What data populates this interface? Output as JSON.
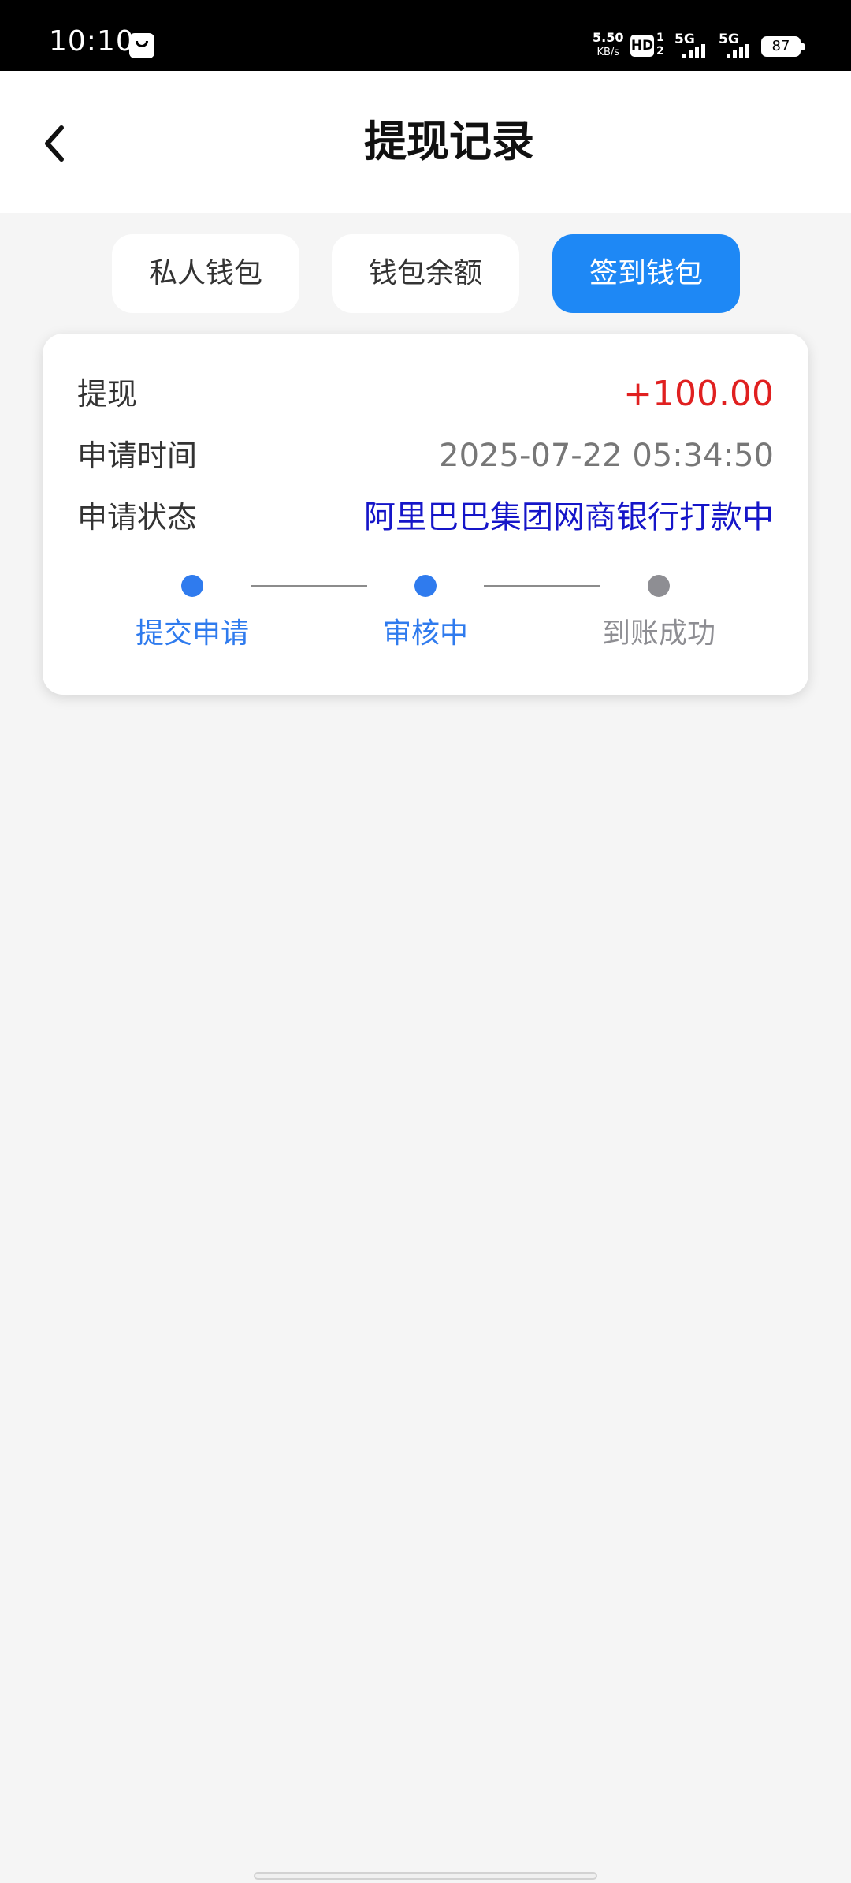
{
  "status_bar": {
    "time": "10:10",
    "net_speed_value": "5.50",
    "net_speed_unit": "KB/s",
    "hd": "HD",
    "hd_sub_top": "1",
    "hd_sub_bottom": "2",
    "signal_1": "5G",
    "signal_2": "5G",
    "battery": "87"
  },
  "header": {
    "title": "提现记录"
  },
  "tabs": [
    {
      "label": "私人钱包",
      "active": false
    },
    {
      "label": "钱包余额",
      "active": false
    },
    {
      "label": "签到钱包",
      "active": true
    }
  ],
  "record": {
    "type_label": "提现",
    "amount": "+100.00",
    "time_label": "申请时间",
    "time_value": "2025-07-22 05:34:50",
    "status_label": "申请状态",
    "status_value": "阿里巴巴集团网商银行打款中",
    "steps": [
      {
        "label": "提交申请",
        "state": "done"
      },
      {
        "label": "审核中",
        "state": "done"
      },
      {
        "label": "到账成功",
        "state": "pending"
      }
    ]
  },
  "colors": {
    "accent": "#1e88f5",
    "amount": "#e02020",
    "status": "#1515c8",
    "step_done": "#2f7bee",
    "step_pending": "#8e8e93"
  }
}
